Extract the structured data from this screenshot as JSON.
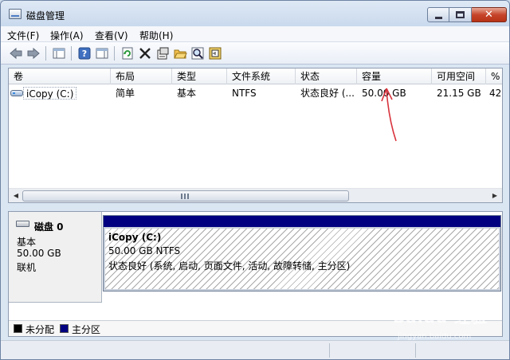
{
  "window": {
    "title": "磁盘管理",
    "close_glyph": "✕"
  },
  "menu": {
    "items": [
      "文件(F)",
      "操作(A)",
      "查看(V)",
      "帮助(H)"
    ]
  },
  "toolbar": {
    "icons": [
      "back-icon",
      "forward-icon",
      "console-tree-icon",
      "help-icon",
      "properties-pane-icon",
      "refresh-icon",
      "delete-icon",
      "properties-icon",
      "open-icon",
      "search-icon",
      "disk-config-icon"
    ]
  },
  "volumes": {
    "columns": [
      "卷",
      "布局",
      "类型",
      "文件系统",
      "状态",
      "容量",
      "可用空间",
      "%"
    ],
    "rows": [
      {
        "name": "iCopy (C:)",
        "layout": "简单",
        "type": "基本",
        "fs": "NTFS",
        "status": "状态良好 (...",
        "capacity": "50.00 GB",
        "free": "21.15 GB",
        "percent": "42"
      }
    ],
    "scroll_grip": "III"
  },
  "disk": {
    "title": "磁盘 0",
    "type": "基本",
    "size": "50.00 GB",
    "state": "联机",
    "partition": {
      "name": "iCopy  (C:)",
      "size_fs": "50.00 GB NTFS",
      "status": "状态良好 (系统, 启动, 页面文件, 活动, 故障转储, 主分区)",
      "header_color": "#000080"
    }
  },
  "legend": {
    "items": [
      {
        "label": "未分配",
        "color": "#000000"
      },
      {
        "label": "主分区",
        "color": "#000080"
      }
    ]
  },
  "watermark": {
    "brand": "Baidu 经验",
    "url": "jingyan.baidu.com"
  }
}
